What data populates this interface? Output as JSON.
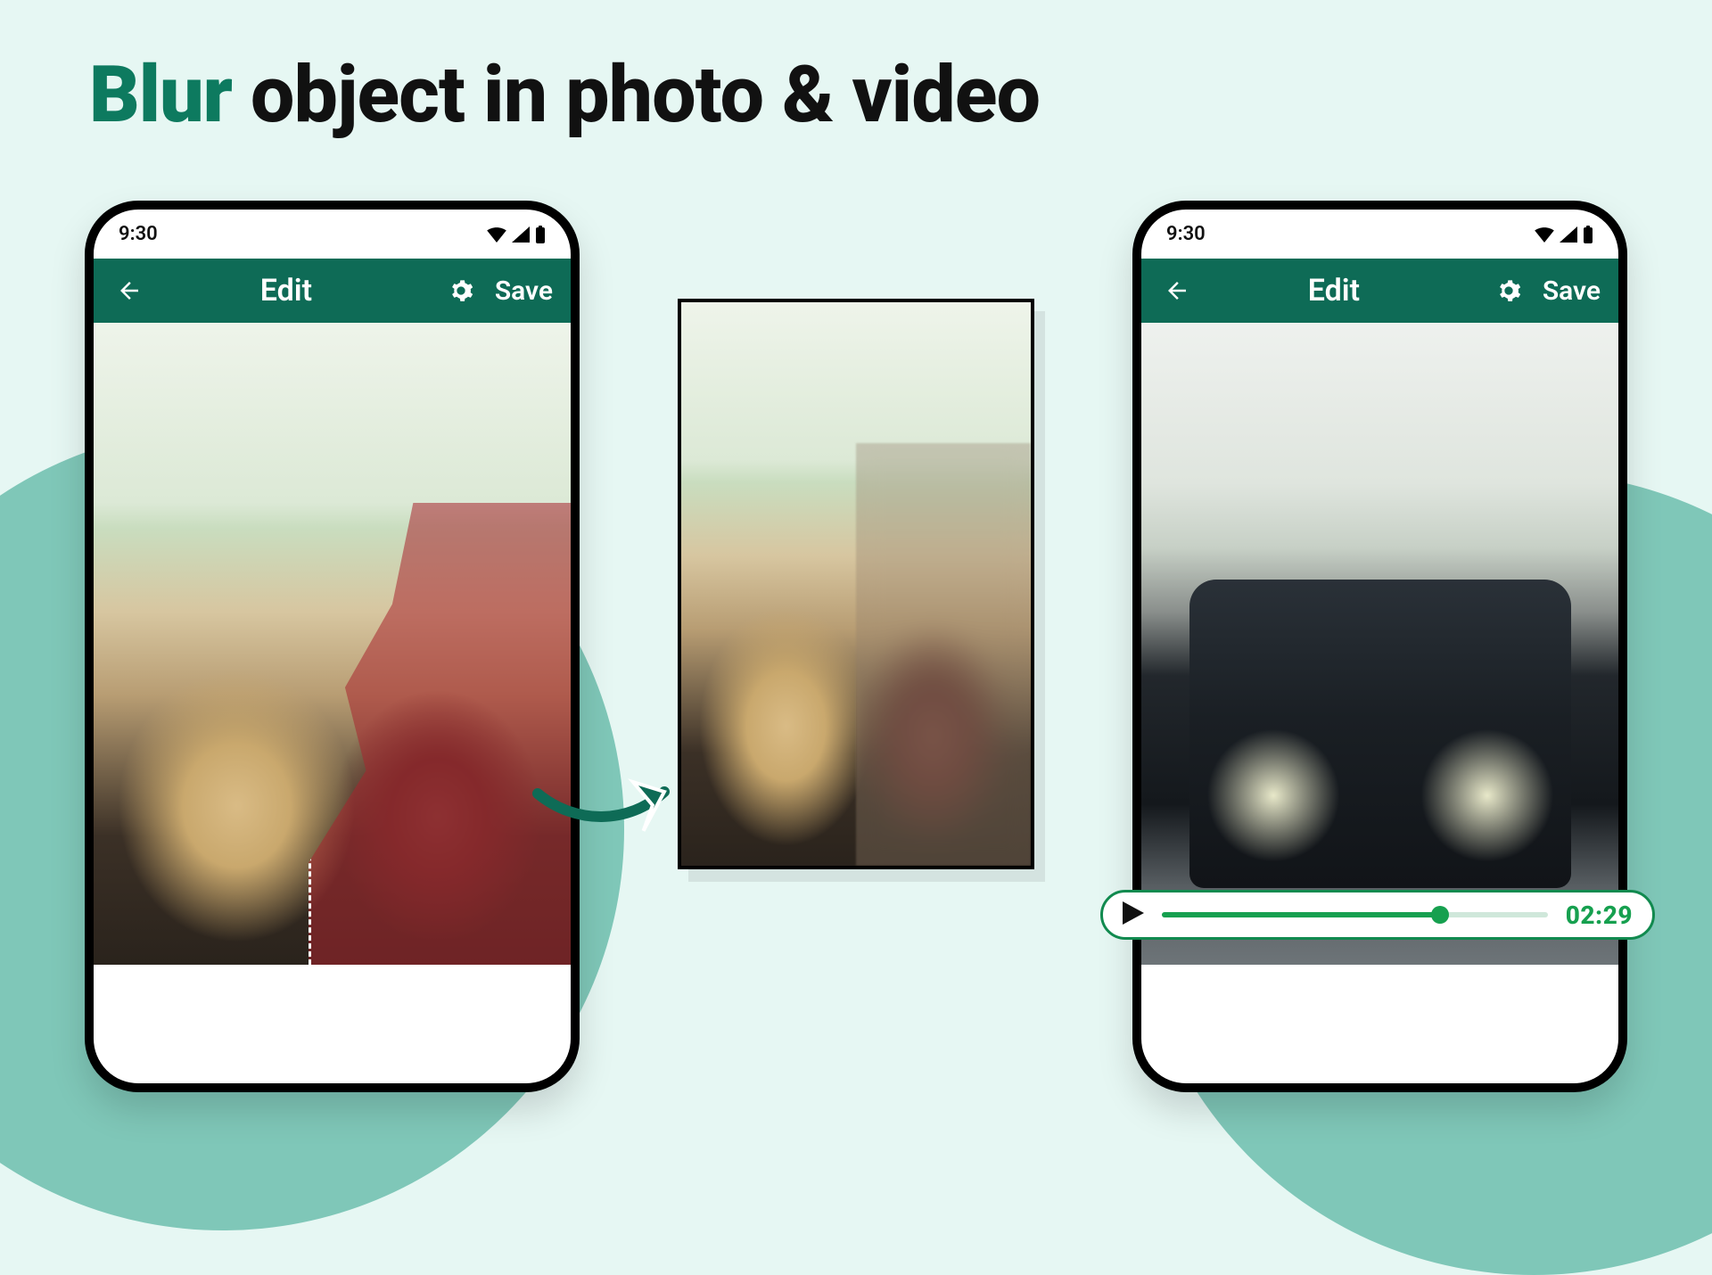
{
  "headline": {
    "accent": "Blur",
    "rest": " object in photo & video"
  },
  "colors": {
    "brand": "#0e6b56",
    "accent_green": "#16a04f"
  },
  "phone_left": {
    "status_time": "9:30",
    "appbar": {
      "title": "Edit",
      "save_label": "Save"
    }
  },
  "phone_right": {
    "status_time": "9:30",
    "appbar": {
      "title": "Edit",
      "save_label": "Save"
    }
  },
  "playback": {
    "timestamp": "02:29",
    "progress_percent": 72
  }
}
